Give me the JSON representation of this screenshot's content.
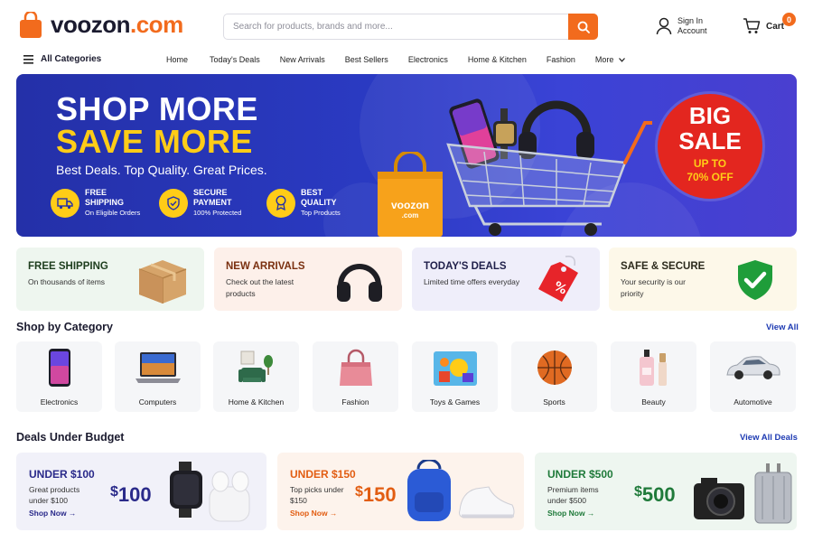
{
  "header": {
    "logo_name": "voozon",
    "logo_tld": ".com",
    "search_placeholder": "Search for products, brands and more...",
    "account_line1": "Sign In",
    "account_line2": "Account",
    "cart_label": "Cart",
    "cart_count": "0"
  },
  "nav": {
    "all_categories": "All Categories",
    "links": [
      "Home",
      "Today's Deals",
      "New Arrivals",
      "Best Sellers",
      "Electronics",
      "Home & Kitchen",
      "Fashion",
      "More"
    ]
  },
  "hero": {
    "title1": "SHOP MORE",
    "title2": "SAVE MORE",
    "subtitle": "Best Deals. Top Quality. Great Prices.",
    "features": [
      {
        "l1": "FREE",
        "l2": "SHIPPING",
        "l3": "On Eligible Orders",
        "icon": "truck-icon"
      },
      {
        "l1": "SECURE",
        "l2": "PAYMENT",
        "l3": "100% Protected",
        "icon": "shield-icon"
      },
      {
        "l1": "BEST",
        "l2": "QUALITY",
        "l3": "Top Products",
        "icon": "medal-icon"
      }
    ],
    "bag_label": "voozon",
    "bag_tld": ".com",
    "sale_l1": "BIG",
    "sale_l2": "SALE",
    "sale_l3": "UP TO",
    "sale_l4": "70% OFF"
  },
  "feature_cards": [
    {
      "title": "FREE SHIPPING",
      "desc": "On thousands of items",
      "color": "#2a5a2a",
      "bg": "#eef6ef"
    },
    {
      "title": "NEW ARRIVALS",
      "desc": "Check out the latest products",
      "color": "#7a3b10",
      "bg": "#fdf0ea"
    },
    {
      "title": "TODAY'S DEALS",
      "desc": "Limited time offers everyday",
      "color": "#2a2a5a",
      "bg": "#efeefa"
    },
    {
      "title": "SAFE & SECURE",
      "desc": "Your security is our priority",
      "color": "#3a3320",
      "bg": "#fdf8e9"
    }
  ],
  "shop_by_category": {
    "title": "Shop by Category",
    "view_all": "View All",
    "items": [
      "Electronics",
      "Computers",
      "Home & Kitchen",
      "Fashion",
      "Toys & Games",
      "Sports",
      "Beauty",
      "Automotive"
    ]
  },
  "deals": {
    "title": "Deals Under Budget",
    "view_all": "View All Deals",
    "cards": [
      {
        "heading": "UNDER $100",
        "desc": "Great products under $100",
        "shop": "Shop Now →",
        "price": "100",
        "color": "#2a2a8a",
        "bg": "#f1f1f9"
      },
      {
        "heading": "UNDER $150",
        "desc": "Top picks under $150",
        "shop": "Shop Now →",
        "price": "150",
        "color": "#e25d12",
        "bg": "#fdf3ec"
      },
      {
        "heading": "UNDER $500",
        "desc": "Premium items under $500",
        "shop": "Shop Now →",
        "price": "500",
        "color": "#1f7a3a",
        "bg": "#eef6f0"
      }
    ]
  },
  "colors": {
    "brand": "#f26b1d",
    "hero_bg": "#2a3ac2",
    "accent_yellow": "#ffcc17",
    "sale_red": "#e3261f",
    "link_blue": "#1e3bb3"
  }
}
